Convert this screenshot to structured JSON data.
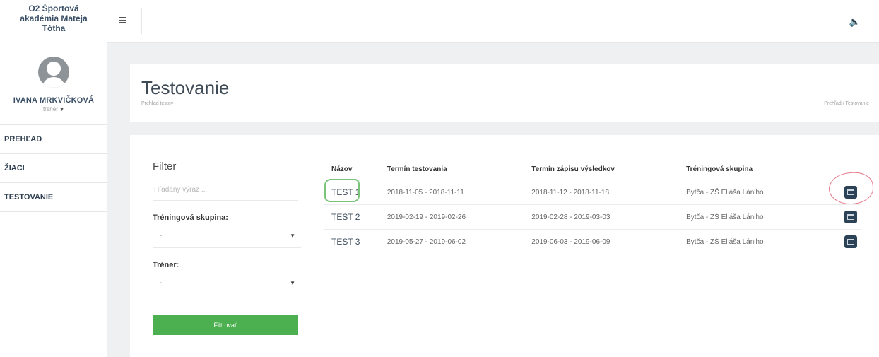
{
  "sidebar": {
    "brand": {
      "line1": "O2 Športová",
      "line2": "akadémia Mateja",
      "line3": "Tótha"
    },
    "user": {
      "name": "IVANA MRKVIČKOVÁ",
      "role": "tréner"
    },
    "items": [
      {
        "label": "PREHĽAD"
      },
      {
        "label": "ŽIACI"
      },
      {
        "label": "TESTOVANIE"
      }
    ]
  },
  "topbar": {
    "menu_icon": "hamburger-icon",
    "notification_icon": "megaphone-icon"
  },
  "header": {
    "title": "Testovanie",
    "subtitle": "Prehľad testov",
    "breadcrumb": "Prehľad / Testovanie"
  },
  "filter": {
    "title": "Filter",
    "search_placeholder": "Hľadaný výraz ...",
    "group_label": "Tréningová skupina:",
    "group_value": "-",
    "trainer_label": "Tréner:",
    "trainer_value": "-",
    "button_label": "Filtrovať",
    "button_color": "#4cb050"
  },
  "table": {
    "headers": [
      "Názov",
      "Termín testovania",
      "Termín zápisu výsledkov",
      "Tréningová skupina"
    ],
    "rows": [
      {
        "name": "TEST 1",
        "testing": "2018-11-05 - 2018-11-11",
        "results": "2018-11-12 - 2018-11-18",
        "group": "Bytča - ZŠ Eliáša Lániho"
      },
      {
        "name": "TEST 2",
        "testing": "2019-02-19 - 2019-02-26",
        "results": "2019-02-28 - 2019-03-03",
        "group": "Bytča - ZŠ Eliáša Lániho"
      },
      {
        "name": "TEST 3",
        "testing": "2019-05-27 - 2019-06-02",
        "results": "2019-06-03 - 2019-06-09",
        "group": "Bytča - ZŠ Eliáša Lániho"
      }
    ],
    "action_icon": "calendar-icon"
  },
  "colors": {
    "brand": "#3a4f66",
    "action_button": "#2c4256",
    "annotation_green": "#7ac47a",
    "annotation_red": "#e77a8a"
  }
}
